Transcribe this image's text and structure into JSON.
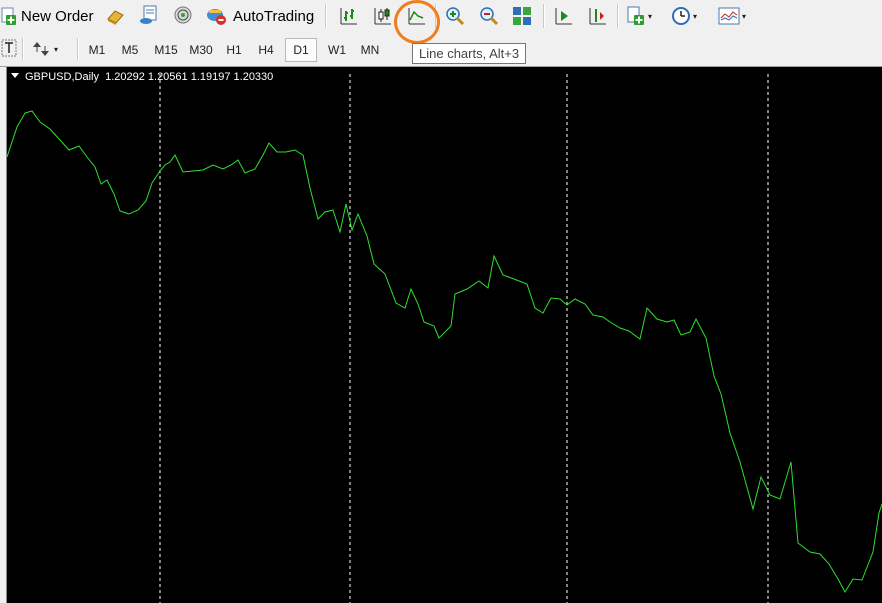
{
  "toolbar": {
    "new_order_label": "New Order",
    "autotrading_label": "AutoTrading",
    "dropdown_arrow": "▾"
  },
  "timeframes": [
    {
      "label": "M1",
      "active": false
    },
    {
      "label": "M5",
      "active": false
    },
    {
      "label": "M15",
      "active": false
    },
    {
      "label": "M30",
      "active": false
    },
    {
      "label": "H1",
      "active": false
    },
    {
      "label": "H4",
      "active": false
    },
    {
      "label": "D1",
      "active": true
    },
    {
      "label": "W1",
      "active": false
    },
    {
      "label": "MN",
      "active": false
    }
  ],
  "tooltip": {
    "text": "Line charts, Alt+3"
  },
  "chart": {
    "title": "GBPUSD,Daily  1.20292 1.20561 1.19197 1.20330",
    "background": "#000000",
    "line_color": "#2ee02e",
    "grid_color": "#ffffff"
  },
  "colors": {
    "highlight_circle": "#f07d1e"
  }
}
